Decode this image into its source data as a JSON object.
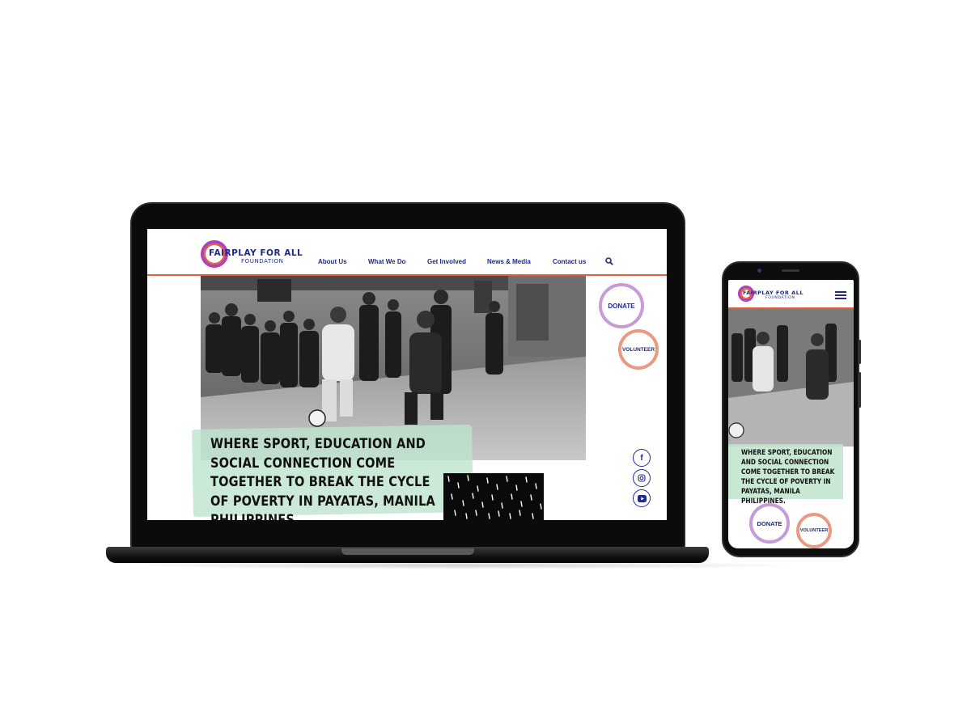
{
  "site": {
    "logo_title": "FAIRPLAY FOR ALL",
    "logo_subtitle": "FOUNDATION",
    "nav": [
      "About Us",
      "What We Do",
      "Get Involved",
      "News & Media",
      "Contact us"
    ],
    "hero_headline": "WHERE SPORT, EDUCATION AND SOCIAL CONNECTION COME TOGETHER TO BREAK THE CYCLE OF POVERTY IN PAYATAS, MANILA PHILIPPINES.",
    "donate_label": "DONATE",
    "volunteer_label": "VOLUNTEER",
    "socials": [
      "facebook-icon",
      "instagram-icon",
      "youtube-icon"
    ]
  },
  "colors": {
    "brand_blue": "#1e2a8c",
    "accent_orange": "#e0613a",
    "accent_purple": "#b040b8",
    "highlight_green": "#bee4cd"
  }
}
